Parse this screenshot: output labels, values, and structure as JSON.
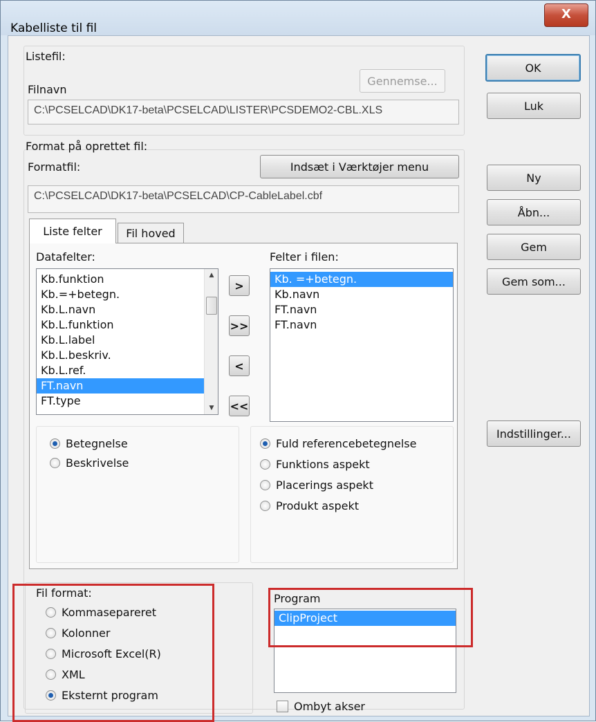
{
  "window": {
    "title": "Kabelliste til fil",
    "close_label": "X"
  },
  "listefil": {
    "group_label": "Listefil:",
    "browse_label": "Gennemse...",
    "filename_label": "Filnavn",
    "filename_value": "C:\\PCSELCAD\\DK17-beta\\PCSELCAD\\LISTER\\PCSDEMO2-CBL.XLS"
  },
  "format": {
    "group_label": "Format på oprettet fil:",
    "formatfile_label": "Formatfil:",
    "insert_menu_label": "Indsæt i Værktøjer menu",
    "formatfile_value": "C:\\PCSELCAD\\DK17-beta\\PCSELCAD\\CP-CableLabel.cbf"
  },
  "tabs": [
    {
      "label": "Liste felter"
    },
    {
      "label": "Fil hoved"
    }
  ],
  "datafields": {
    "label": "Datafelter:",
    "items": [
      "Kb.funktion",
      "Kb.=+betegn.",
      "Kb.L.navn",
      "Kb.L.funktion",
      "Kb.L.label",
      "Kb.L.beskriv.",
      "Kb.L.ref.",
      "FT.navn",
      "FT.type"
    ],
    "selected_index": 7
  },
  "transfer": {
    "add": ">",
    "add_all": ">>",
    "remove": "<",
    "remove_all": "<<"
  },
  "filefields": {
    "label": "Felter i filen:",
    "items": [
      "Kb. =+betegn.",
      "Kb.navn",
      "FT.navn",
      "FT.navn"
    ],
    "selected_index": 0
  },
  "name_options": [
    {
      "label": "Betegnelse",
      "checked": true
    },
    {
      "label": "Beskrivelse",
      "checked": false
    }
  ],
  "ref_options": [
    {
      "label": "Fuld referencebetegnelse",
      "checked": true
    },
    {
      "label": "Funktions aspekt",
      "checked": false
    },
    {
      "label": "Placerings aspekt",
      "checked": false
    },
    {
      "label": "Produkt aspekt",
      "checked": false
    }
  ],
  "fileformat": {
    "label": "Fil format:",
    "options": [
      {
        "label": "Kommasepareret",
        "checked": false
      },
      {
        "label": "Kolonner",
        "checked": false
      },
      {
        "label": "Microsoft Excel(R)",
        "checked": false
      },
      {
        "label": "XML",
        "checked": false
      },
      {
        "label": "Eksternt program",
        "checked": true
      }
    ]
  },
  "program": {
    "label": "Program",
    "items": [
      "ClipProject"
    ],
    "selected_index": 0
  },
  "swap_axes": {
    "label": "Ombyt akser",
    "checked": false
  },
  "buttons": {
    "ok": "OK",
    "close": "Luk",
    "new": "Ny",
    "open": "Åbn...",
    "save": "Gem",
    "save_as": "Gem som...",
    "settings": "Indstillinger..."
  },
  "colors": {
    "selection": "#3399ff",
    "highlight_box": "#cc2b2b",
    "title_bg": "#d9e6f2"
  }
}
